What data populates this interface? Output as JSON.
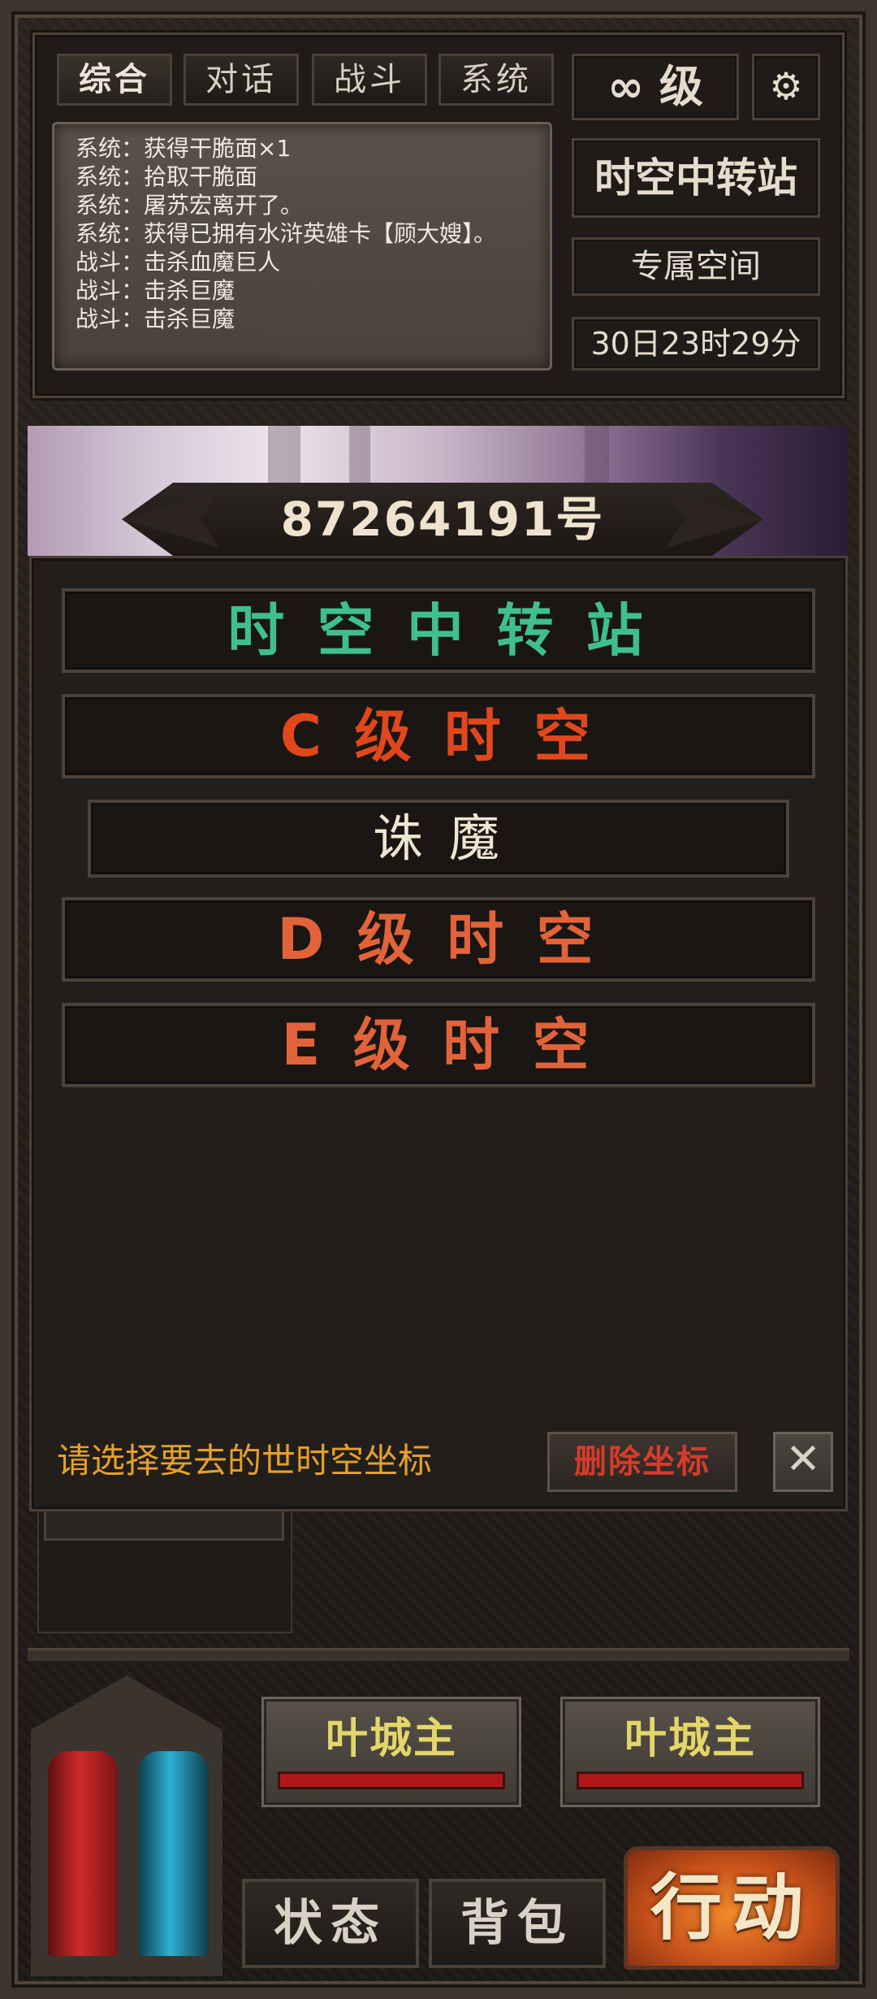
{
  "chat": {
    "tabs": [
      {
        "label": "综合",
        "active": true
      },
      {
        "label": "对话",
        "active": false
      },
      {
        "label": "战斗",
        "active": false
      },
      {
        "label": "系统",
        "active": false
      }
    ],
    "log": [
      "系统：获得干脆面×1",
      "系统：拾取干脆面",
      "系统：屠苏宏离开了。",
      "系统：获得已拥有水浒英雄卡【顾大嫂】。",
      "战斗：击杀血魔巨人",
      "战斗：击杀巨魔",
      "战斗：击杀巨魔"
    ]
  },
  "side": {
    "level": "∞ 级",
    "location": "时空中转站",
    "space": "专属空间",
    "timer": "30日23时29分"
  },
  "banner": {
    "title": "87264191号"
  },
  "dialog": {
    "options": [
      {
        "label": "时 空 中 转 站",
        "color": "#3fbf8f"
      },
      {
        "label": "C 级 时 空",
        "color": "#e2471c"
      },
      {
        "label": "诛 魔",
        "color": "#f1e5d2"
      },
      {
        "label": "D 级 时 空",
        "color": "#e2633a"
      },
      {
        "label": "E 级 时 空",
        "color": "#e2633a"
      }
    ],
    "prompt": "请选择要去的世时空坐标",
    "delete_label": "删除坐标",
    "close_label": "✕"
  },
  "bottom": {
    "name1": "叶城主",
    "name2": "叶城主",
    "hp1": 1.0,
    "hp2": 1.0,
    "status_label": "状态",
    "bag_label": "背包",
    "action_label": "行动"
  },
  "colors": {
    "accent_green": "#3fbf8f",
    "accent_red": "#e2471c",
    "prompt_orange": "#e5a02a"
  }
}
